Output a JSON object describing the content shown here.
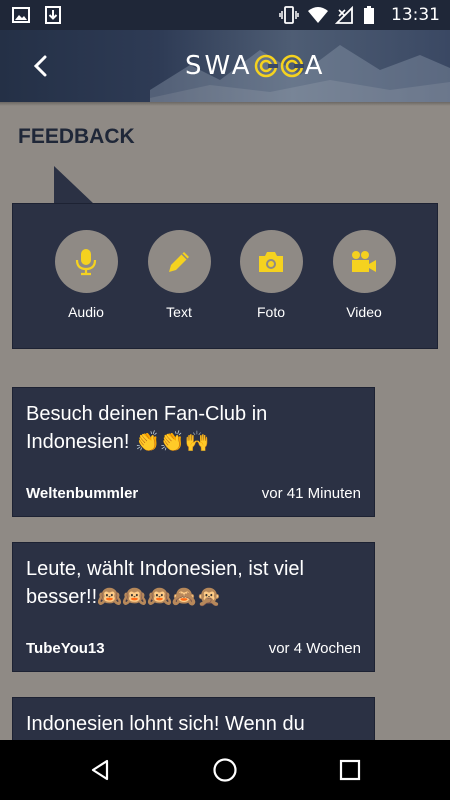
{
  "status_bar": {
    "time": "13:31",
    "left_icons": [
      "image-icon",
      "download-icon"
    ],
    "right_icons": [
      "vibrate-icon",
      "wifi-icon",
      "no-signal-icon",
      "battery-icon"
    ]
  },
  "header": {
    "logo_text_left": "SWA",
    "logo_text_right": "A",
    "back_icon": "chevron-left-icon"
  },
  "feedback": {
    "title": "FEEDBACK",
    "options": [
      {
        "label": "Audio",
        "icon": "microphone-icon"
      },
      {
        "label": "Text",
        "icon": "pencil-icon"
      },
      {
        "label": "Foto",
        "icon": "camera-icon"
      },
      {
        "label": "Video",
        "icon": "video-camera-icon"
      }
    ]
  },
  "posts": [
    {
      "text": "Besuch deinen Fan-Club in Indonesien! ",
      "emoji": "👏👏🙌",
      "author": "Weltenbummler",
      "time": "vor 41 Minuten"
    },
    {
      "text": "Leute, wählt Indonesien, ist viel besser!!",
      "emoji": "🙉🙉🙉🙈🙊",
      "author": "TubeYou13",
      "time": "vor 4 Wochen"
    },
    {
      "text": "Indonesien lohnt sich! Wenn du",
      "emoji": "",
      "author": "",
      "time": ""
    }
  ],
  "nav_bar": {
    "icons": [
      "back-triangle-icon",
      "home-circle-icon",
      "recents-square-icon"
    ]
  },
  "colors": {
    "background": "#8f8a85",
    "panel": "#2b3144",
    "accent": "#f5d21f",
    "header": "#1f2738"
  }
}
